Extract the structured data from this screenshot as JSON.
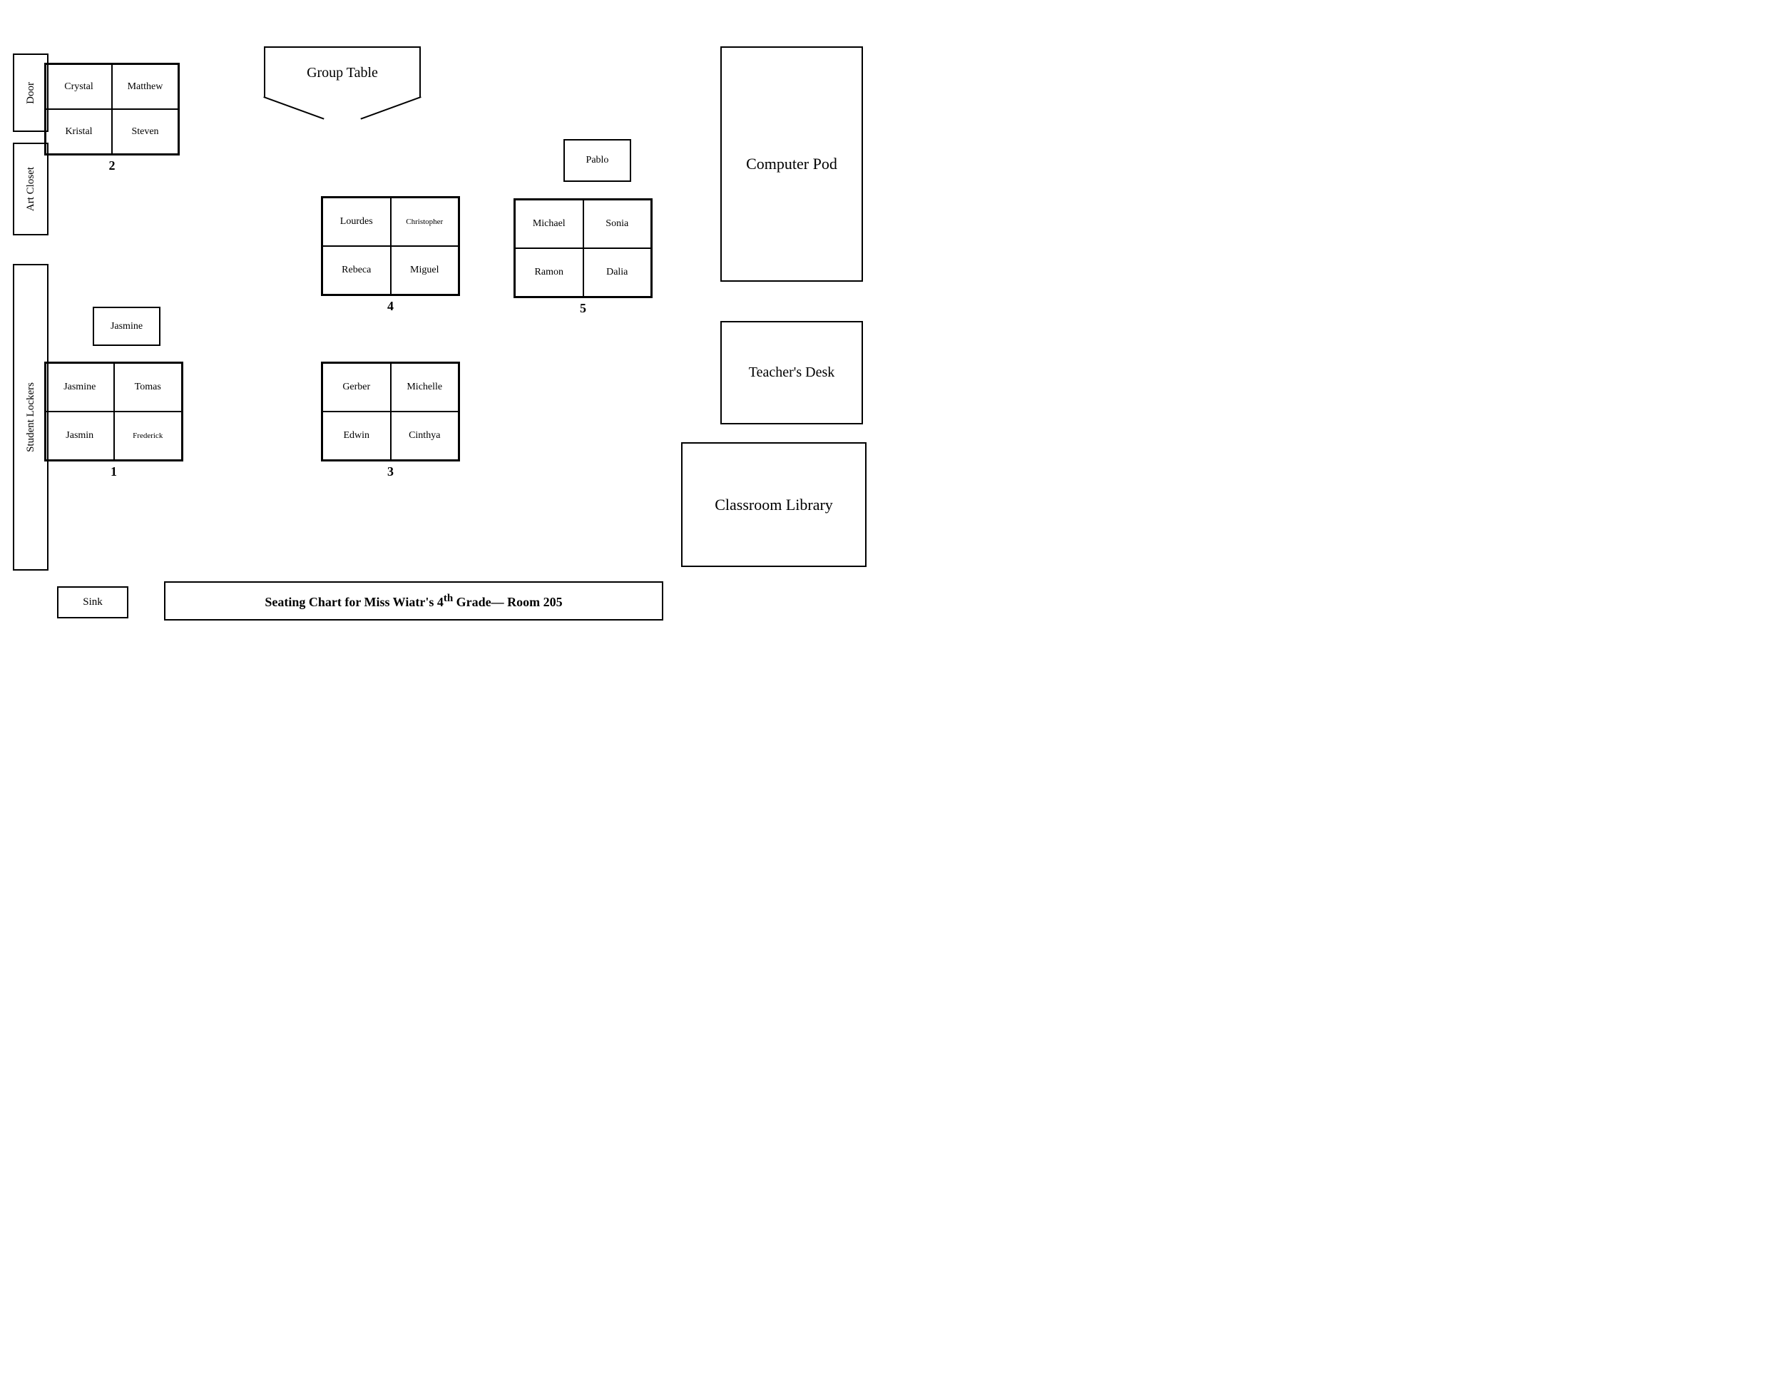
{
  "title": "Seating Chart for Miss Wiatr's 4th Grade— Room 205",
  "room_elements": {
    "door": "Door",
    "art_closet": "Art Closet",
    "student_lockers": "Student Lockers",
    "sink": "Sink",
    "computer_pod": "Computer Pod",
    "teachers_desk": "Teacher's Desk",
    "classroom_library": "Classroom Library",
    "group_table": "Group Table"
  },
  "groups": {
    "group1": {
      "number": "1",
      "standalone": "Jasmine",
      "cells": [
        "Jasmine",
        "Tomas",
        "Jasmin",
        "Frederick"
      ]
    },
    "group2": {
      "number": "2",
      "cells": [
        "Crystal",
        "Matthew",
        "Kristal",
        "Steven"
      ]
    },
    "group3": {
      "number": "3",
      "cells": [
        "Gerber",
        "Michelle",
        "Edwin",
        "Cinthya"
      ]
    },
    "group4": {
      "number": "4",
      "cells": [
        "Lourdes",
        "Christopher",
        "Rebeca",
        "Miguel"
      ]
    },
    "group5": {
      "number": "5",
      "standalone": "Pablo",
      "cells": [
        "Michael",
        "Sonia",
        "Ramon",
        "Dalia"
      ]
    }
  }
}
